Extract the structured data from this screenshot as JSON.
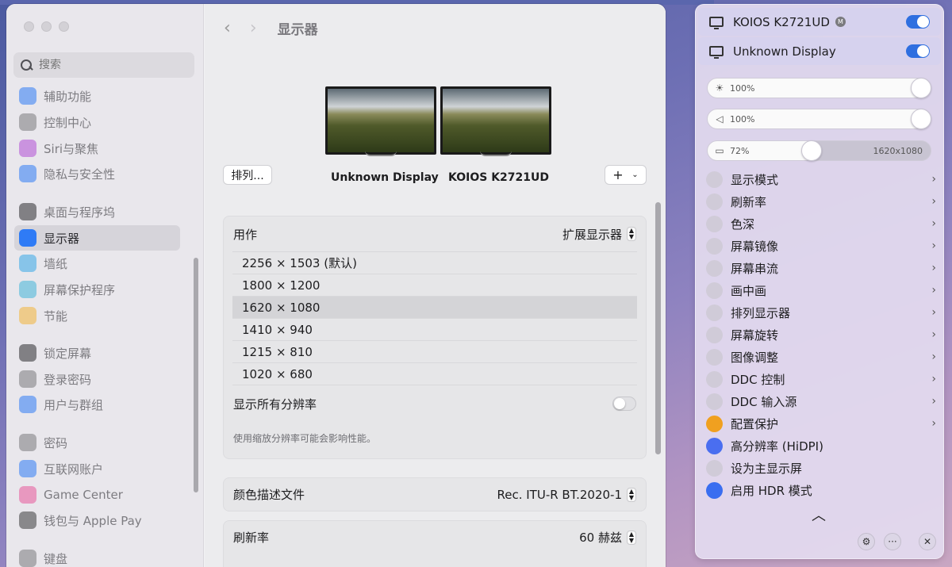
{
  "sidebar": {
    "search_placeholder": "搜索",
    "items": [
      {
        "label": "辅助功能",
        "icon": "accessibility-icon",
        "color": "#2f7bf6"
      },
      {
        "label": "控制中心",
        "icon": "control-center-icon",
        "color": "#7a7a7e"
      },
      {
        "label": "Siri与聚焦",
        "icon": "siri-icon",
        "color": "#b04fd6"
      },
      {
        "label": "隐私与安全性",
        "icon": "hand-icon",
        "color": "#2f7bf6"
      },
      {
        "label": "桌面与程序坞",
        "icon": "dock-icon",
        "color": "#2c2c30"
      },
      {
        "label": "显示器",
        "icon": "display-brightness-icon",
        "color": "#2f7bf6"
      },
      {
        "label": "墙纸",
        "icon": "wallpaper-icon",
        "color": "#37a8e8"
      },
      {
        "label": "屏幕保护程序",
        "icon": "screensaver-icon",
        "color": "#41b4d8"
      },
      {
        "label": "节能",
        "icon": "lightbulb-icon",
        "color": "#f2b53a"
      },
      {
        "label": "锁定屏幕",
        "icon": "lock-icon",
        "color": "#2c2c30"
      },
      {
        "label": "登录密码",
        "icon": "login-lock-icon",
        "color": "#7a7a7e"
      },
      {
        "label": "用户与群组",
        "icon": "users-icon",
        "color": "#2f7bf6"
      },
      {
        "label": "密码",
        "icon": "key-icon",
        "color": "#7a7a7e"
      },
      {
        "label": "互联网账户",
        "icon": "at-icon",
        "color": "#2f7bf6"
      },
      {
        "label": "Game Center",
        "icon": "game-center-icon",
        "color": "#e8589a"
      },
      {
        "label": "钱包与 Apple Pay",
        "icon": "wallet-icon",
        "color": "#3a3a3c"
      },
      {
        "label": "键盘",
        "icon": "keyboard-icon",
        "color": "#7a7a7e"
      }
    ]
  },
  "main": {
    "title": "显示器",
    "arrange_label": "排列...",
    "displays": [
      "Unknown Display",
      "KOIOS K2721UD"
    ],
    "add_label": "+",
    "use_as": {
      "label": "用作",
      "value": "扩展显示器"
    },
    "resolutions": [
      "2256 × 1503 (默认)",
      "1800 × 1200",
      "1620 × 1080",
      "1410 × 940",
      "1215 × 810",
      "1020 × 680"
    ],
    "selected_resolution_index": 2,
    "show_all_label": "显示所有分辨率",
    "hint": "使用缩放分辨率可能会影响性能。",
    "color_profile": {
      "label": "颜色描述文件",
      "value": "Rec. ITU-R BT.2020-1"
    },
    "refresh": {
      "label": "刷新率",
      "value": "60 赫兹"
    }
  },
  "panel": {
    "displays": [
      {
        "name": "KOIOS K2721UD",
        "badge": "M",
        "enabled": true
      },
      {
        "name": "Unknown Display",
        "enabled": true
      }
    ],
    "brightness": "100%",
    "volume": "100%",
    "scale": {
      "value": "72%",
      "resolution": "1620x1080",
      "level": 0.45
    },
    "menu": [
      {
        "label": "显示模式",
        "icon": "display-mode-icon",
        "arrow": true
      },
      {
        "label": "刷新率",
        "icon": "refresh-rate-icon",
        "arrow": true
      },
      {
        "label": "色深",
        "icon": "palette-icon",
        "arrow": true
      },
      {
        "label": "屏幕镜像",
        "icon": "mirror-icon",
        "arrow": true
      },
      {
        "label": "屏幕串流",
        "icon": "stream-icon",
        "arrow": true
      },
      {
        "label": "画中画",
        "icon": "pip-icon",
        "arrow": true
      },
      {
        "label": "排列显示器",
        "icon": "arrange-icon",
        "arrow": true
      },
      {
        "label": "屏幕旋转",
        "icon": "rotate-icon",
        "arrow": true
      },
      {
        "label": "图像调整",
        "icon": "image-adjust-icon",
        "arrow": true
      },
      {
        "label": "DDC 控制",
        "icon": "ddc-control-icon",
        "arrow": true
      },
      {
        "label": "DDC 输入源",
        "icon": "ddc-input-icon",
        "arrow": true
      },
      {
        "label": "配置保护",
        "icon": "shield-icon",
        "arrow": true,
        "color": "#f0a020"
      },
      {
        "label": "高分辨率 (HiDPI)",
        "icon": "sparkle-icon",
        "arrow": false,
        "color": "#4a6ef0"
      },
      {
        "label": "设为主显示屏",
        "icon": "main-display-icon",
        "arrow": false
      },
      {
        "label": "启用 HDR 模式",
        "icon": "layers-icon",
        "arrow": false,
        "color": "#3a6ef0"
      }
    ]
  }
}
